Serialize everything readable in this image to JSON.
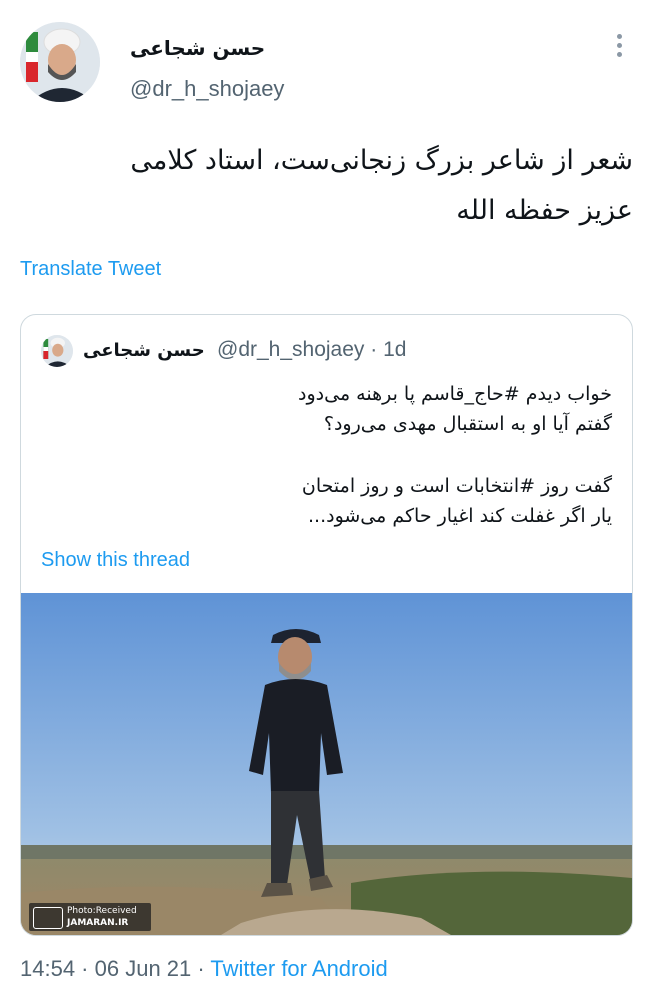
{
  "author": {
    "display_name": "حسن شجاعی",
    "handle": "@dr_h_shojaey"
  },
  "tweet": {
    "text_line1": "شعر از شاعر بزرگ زنجانی‌ست، استاد کلامی",
    "text_line2": "عزیز حفظه الله",
    "translate_label": "Translate Tweet"
  },
  "quote": {
    "display_name": "حسن شجاعی",
    "handle_time": "@dr_h_shojaey · 1d",
    "lines": [
      "خواب دیدم #حاج_قاسم پا برهنه می‌دود",
      "گفتم آیا او به استقبال مهدی می‌رود؟",
      "گفت روز #انتخابات است و روز امتحان",
      "یار اگر غفلت کند اغیار حاکم می‌شود..."
    ],
    "show_thread_label": "Show this thread",
    "watermark": {
      "line1": "Photo:Received",
      "line2": "JAMARAN.IR"
    }
  },
  "footer": {
    "time": "14:54",
    "separator1": " · ",
    "date": "06 Jun 21",
    "separator2": " · ",
    "source": "Twitter for Android"
  },
  "colors": {
    "link": "#1d9bf0",
    "secondary_text": "#536471",
    "border": "#cfd9de"
  },
  "icons": [
    "more-options-icon"
  ]
}
